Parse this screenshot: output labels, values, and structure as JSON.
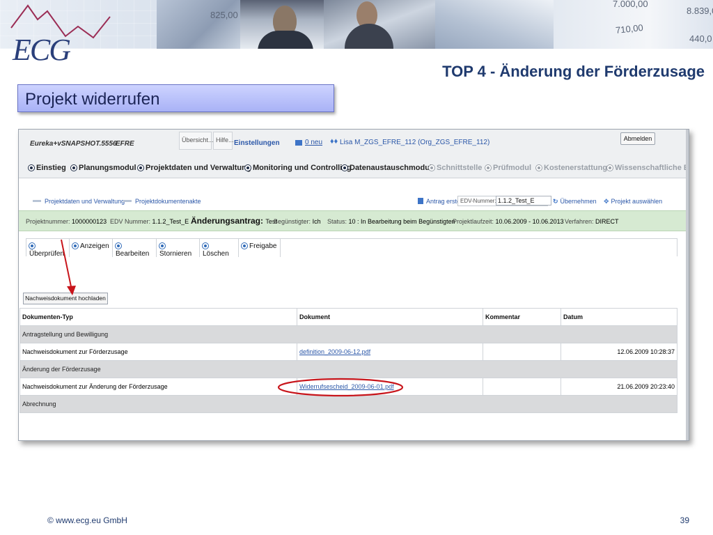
{
  "banner": {
    "logo_text": "ECG",
    "money_values": [
      "825,00",
      "7.000,00",
      "8.839,0",
      "710,00",
      "440,0"
    ]
  },
  "slide": {
    "title": "TOP 4 - Änderung der Förderzusage",
    "subtitle": "Projekt widerrufen"
  },
  "app": {
    "brand": "Eureka+vSNAPSHOT.5556",
    "brand_program": "EFRE",
    "mini_tabs": [
      "Übersicht...",
      "Hilfe..."
    ],
    "settings_link": "Einstellungen",
    "messages_link": "0 neu",
    "user": "Lisa M_ZGS_EFRE_112 (Org_ZGS_EFRE_112)",
    "logout_button": "Abmelden",
    "nav": [
      {
        "label": "Einstieg",
        "enabled": true
      },
      {
        "label": "Planungsmodul",
        "enabled": true
      },
      {
        "label": "Projektdaten und Verwaltung",
        "enabled": true
      },
      {
        "label": "Monitoring und Controlling",
        "enabled": true
      },
      {
        "label": "Datenaustauschmodul",
        "enabled": true
      },
      {
        "label": "Schnittstelle",
        "enabled": false
      },
      {
        "label": "Prüfmodul",
        "enabled": false
      },
      {
        "label": "Kostenerstattung",
        "enabled": false
      },
      {
        "label": "Wissenschaftliche Begle",
        "enabled": false
      }
    ],
    "breadcrumbs": [
      "Projektdaten und Verwaltung",
      "Projektdokumentenakte"
    ],
    "antrag_link": "Antrag erstellen",
    "edv_label": "EDV-Nummer:",
    "edv_value": "1.1.2_Test_E",
    "uebernehmen_link": "Übernehmen",
    "project_select_link": "Projekt auswählen",
    "info": {
      "projektnummer_label": "Projektnummer:",
      "projektnummer": "1000000123",
      "edv_label": "EDV Nummer:",
      "edv": "1.1.2_Test_E",
      "antrag_label": "Änderungsantrag:",
      "antrag": "Test",
      "beg_label": "Begünstigter:",
      "beg": "Ich",
      "status_label": "Status:",
      "status": "10 : In Bearbeitung beim Begünstigten",
      "laufzeit_label": "Projektlaufzeit:",
      "laufzeit": "10.06.2009 - 10.06.2013",
      "verfahren_label": "Verfahren:",
      "verfahren": "DIRECT"
    },
    "actions": [
      "Überprüfen",
      "Anzeigen",
      "Bearbeiten",
      "Stornieren",
      "Löschen",
      "Freigabe"
    ],
    "upload_button": "Nachweisdokument hochladen",
    "table": {
      "headers": [
        "Dokumenten-Typ",
        "Dokument",
        "Kommentar",
        "Datum"
      ],
      "rows": [
        {
          "group": "Antragstellung und Bewilligung"
        },
        {
          "type": "Nachweisdokument zur Förderzusage",
          "doc": "definition_2009-06-12.pdf",
          "comment": "",
          "date": "12.06.2009 10:28:37"
        },
        {
          "group": "Änderung der Förderzusage"
        },
        {
          "type": "Nachweisdokument zur Änderung der Förderzusage",
          "doc": "Widerrufsescheid_2009-06-01.pdf",
          "comment": "",
          "date": "21.06.2009 20:23:40"
        },
        {
          "group": "Abrechnung"
        }
      ]
    }
  },
  "colors": {
    "title": "#1f3a6e",
    "annotation_red": "#c8151b",
    "info_bar": "#d6ead2",
    "group_row": "#d9dadc"
  },
  "footer": {
    "copyright": "© www.ecg.eu GmbH",
    "page": "39"
  }
}
